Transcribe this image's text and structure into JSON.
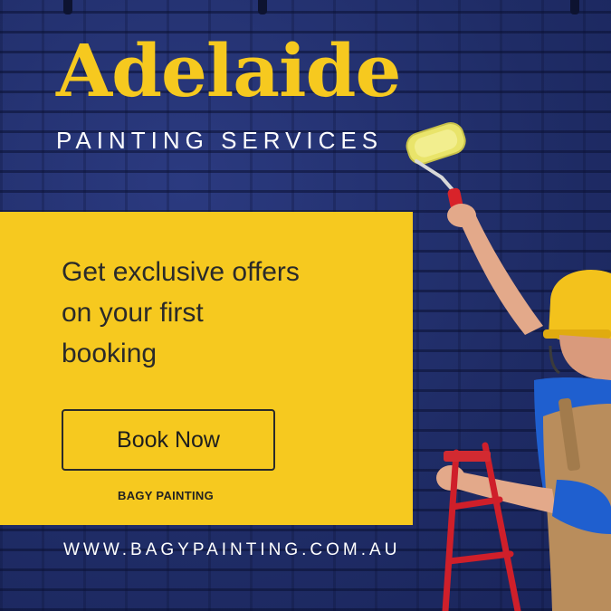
{
  "ad": {
    "headline": "Adelaide",
    "subheadline": "PAINTING SERVICES",
    "offer_lines": [
      "Get exclusive offers",
      "on your first",
      "booking"
    ],
    "cta_label": "Book Now",
    "brand_name": "BAGY PAINTING",
    "website": "WWW.BAGYPAINTING.COM.AU"
  },
  "colors": {
    "wall_blue": "#1f2c66",
    "accent_yellow": "#f6c91f",
    "text_dark": "#2a2a2a",
    "text_light": "#ffffff"
  },
  "icons": {
    "illustration": "painter-with-roller-icon"
  }
}
